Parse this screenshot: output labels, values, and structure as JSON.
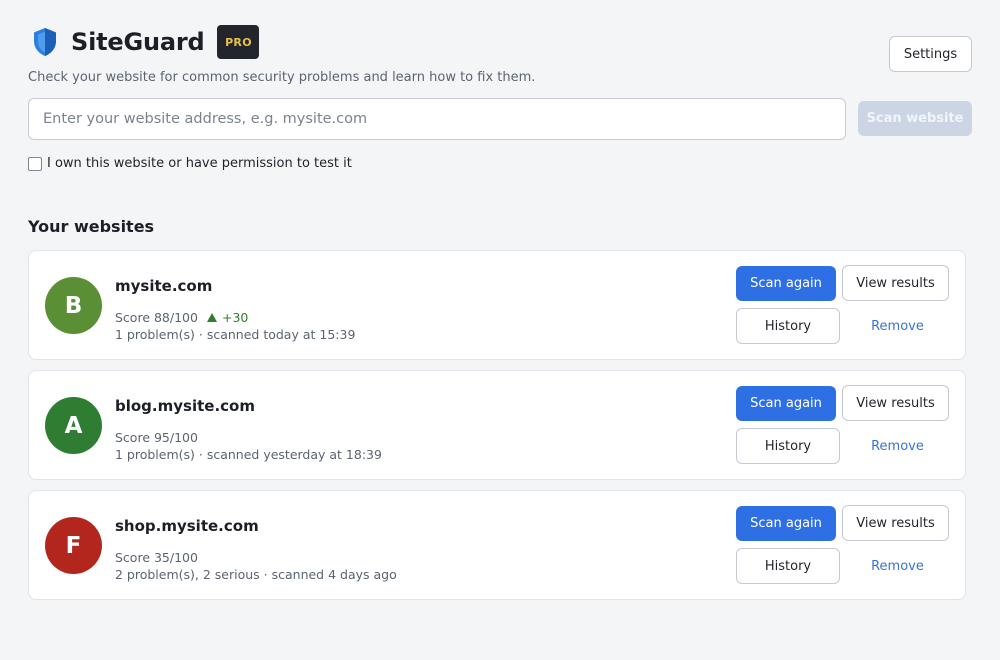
{
  "header": {
    "app_title": "SiteGuard",
    "badge": "PRO",
    "settings_label": "Settings",
    "subtitle": "Check your website for common security problems and learn how to fix them."
  },
  "scan": {
    "placeholder": "Enter your website address, e.g. mysite.com",
    "value": "",
    "button_label": "Scan website",
    "permission_label": "I own this website or have permission to test it",
    "permission_checked": false
  },
  "section_title": "Your websites",
  "sites": [
    {
      "grade": "B",
      "grade_color": "#5a8f35",
      "name": "mysite.com",
      "score": "Score 88/100",
      "trend": "+30",
      "meta": "1 problem(s) · scanned today at 15:39",
      "scan_again": "Scan again",
      "view_results": "View results",
      "history": "History",
      "remove": "Remove"
    },
    {
      "grade": "A",
      "grade_color": "#2e7d32",
      "name": "blog.mysite.com",
      "score": "Score 95/100",
      "trend": "",
      "meta": "1 problem(s) · scanned yesterday at 18:39",
      "scan_again": "Scan again",
      "view_results": "View results",
      "history": "History",
      "remove": "Remove"
    },
    {
      "grade": "F",
      "grade_color": "#b3261e",
      "name": "shop.mysite.com",
      "score": "Score 35/100",
      "trend": "",
      "meta": "2 problem(s), 2 serious · scanned 4 days ago",
      "scan_again": "Scan again",
      "view_results": "View results",
      "history": "History",
      "remove": "Remove"
    }
  ],
  "colors": {
    "accent": "#2f6fe4",
    "disabled_button": "#cbd5e3",
    "trend_up": "#2f7d2f",
    "link": "#3a73d6",
    "shield": "#2a7fe0"
  },
  "icons": {
    "brand": "shield-icon",
    "trend": "triangle-up-icon"
  }
}
